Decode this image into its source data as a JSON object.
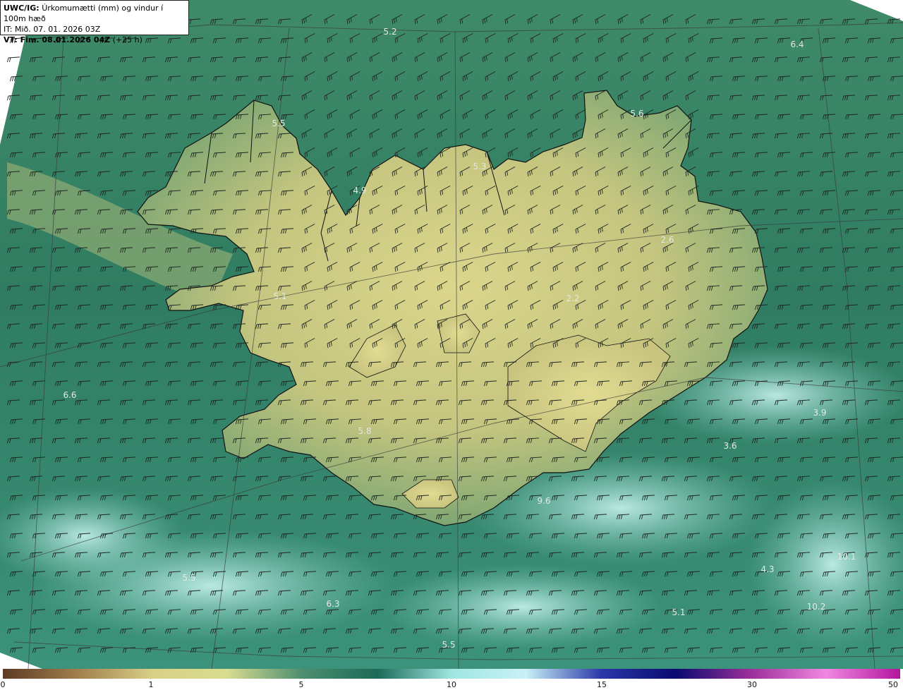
{
  "header": {
    "model": "UWC/IG:",
    "title": "Úrkomumætti (mm) og vindur í 100m hæð",
    "init_time": "IT: Mið. 07. 01. 2026 03Z",
    "valid_prefix": "VT: Fim. 08.01.2026 04Z",
    "valid_suffix": " (+25 h)"
  },
  "colorbar": {
    "ticks": [
      "0",
      "1",
      "5",
      "10",
      "15",
      "30",
      "50"
    ],
    "colors": [
      "#5e3a25",
      "#a07e4c",
      "#d9d088",
      "#d8dc90",
      "#4e8f6f",
      "#1b6a58",
      "#9fe6e0",
      "#c9f1f7",
      "#2a38a8",
      "#0a0a70",
      "#9b2f9b",
      "#f088e0",
      "#b2159e"
    ]
  },
  "map": {
    "value_labels": [
      "5.2",
      "6.4",
      "5.6",
      "5.5",
      "5.3",
      "4.9",
      "2.6",
      "5.1",
      "2.2",
      "6.6",
      "5.8",
      "3.9",
      "3.6",
      "9.6",
      "4.3",
      "10.1",
      "5.5",
      "6.3",
      "10.2",
      "5.1",
      "5.5"
    ],
    "colors": {
      "sea": "#2f7c62",
      "land_low": "#d9d286",
      "land_mid": "#8fb46f",
      "coast": "#111111",
      "barb": "#1f2622",
      "grid": "#3a3a3a",
      "label": "#e4e8e2",
      "precip_high": "#b6efec"
    }
  }
}
